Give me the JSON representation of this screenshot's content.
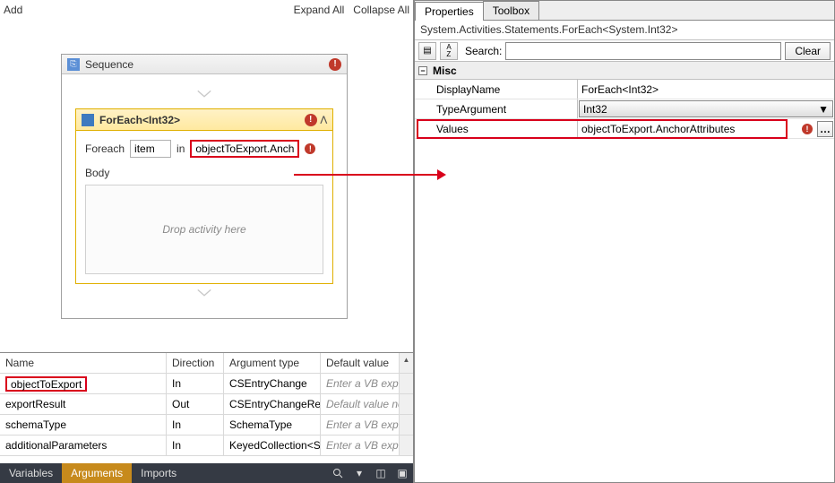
{
  "toolbar": {
    "add": "Add",
    "expand_all": "Expand All",
    "collapse_all": "Collapse All"
  },
  "sequence": {
    "title": "Sequence"
  },
  "foreach": {
    "title": "ForEach<Int32>",
    "foreach_label": "Foreach",
    "item_value": "item",
    "in_label": "in",
    "expr_value": "objectToExport.Anchor",
    "body_label": "Body",
    "drop_hint": "Drop activity here"
  },
  "arguments": {
    "headers": {
      "name": "Name",
      "direction": "Direction",
      "type": "Argument type",
      "default": "Default value"
    },
    "rows": [
      {
        "name": "objectToExport",
        "direction": "In",
        "type": "CSEntryChange",
        "default": "Enter a VB express",
        "highlight": true,
        "placeholder": true
      },
      {
        "name": "exportResult",
        "direction": "Out",
        "type": "CSEntryChangeRe",
        "default": "Default value not su",
        "placeholder": true
      },
      {
        "name": "schemaType",
        "direction": "In",
        "type": "SchemaType",
        "default": "Enter a VB express",
        "placeholder": true
      },
      {
        "name": "additionalParameters",
        "direction": "In",
        "type": "KeyedCollection<S",
        "default": "Enter a VB express",
        "placeholder": true
      }
    ]
  },
  "bottom_tabs": {
    "variables": "Variables",
    "arguments": "Arguments",
    "imports": "Imports"
  },
  "properties": {
    "tab_properties": "Properties",
    "tab_toolbox": "Toolbox",
    "class_name": "System.Activities.Statements.ForEach<System.Int32>",
    "search_label": "Search:",
    "clear": "Clear",
    "category": "Misc",
    "display_name_label": "DisplayName",
    "display_name_value": "ForEach<Int32>",
    "type_arg_label": "TypeArgument",
    "type_arg_value": "Int32",
    "values_label": "Values",
    "values_value": "objectToExport.AnchorAttributes"
  }
}
